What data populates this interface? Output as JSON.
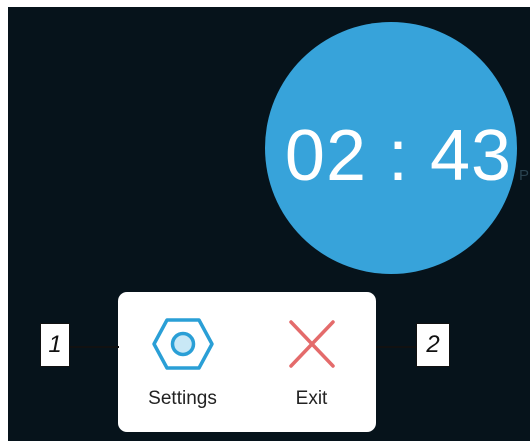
{
  "clock": {
    "time": "02 : 43",
    "suffix": "P"
  },
  "menu": {
    "settings_label": "Settings",
    "exit_label": "Exit"
  },
  "callouts": {
    "left": "1",
    "right": "2"
  },
  "colors": {
    "screen_background": "#06131b",
    "clock_circle": "#37a3da",
    "settings_icon": "#2a9fd6",
    "exit_icon": "#e46b6b"
  }
}
